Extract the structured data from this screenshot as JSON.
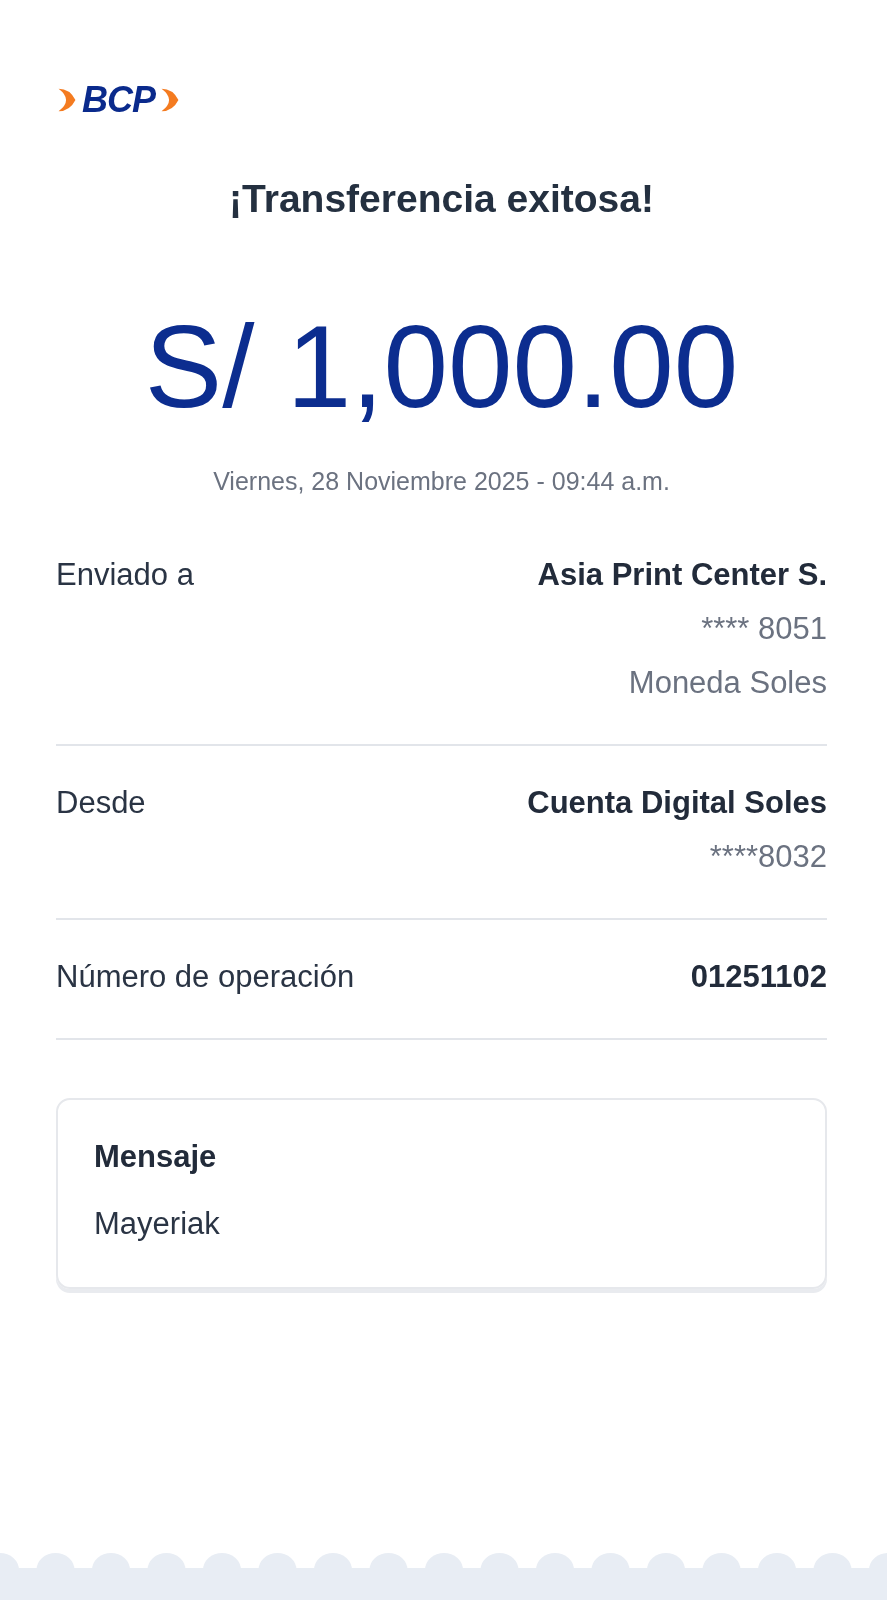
{
  "logo": {
    "text": "BCP"
  },
  "title": "¡Transferencia exitosa!",
  "amount": "S/ 1,000.00",
  "date": "Viernes, 28 Noviembre 2025 - 09:44 a.m.",
  "details": [
    {
      "label": "Enviado a",
      "lines": [
        "Asia Print Center S.",
        "**** 8051",
        "Moneda Soles"
      ]
    },
    {
      "label": "Desde",
      "lines": [
        "Cuenta Digital Soles",
        "****8032"
      ]
    },
    {
      "label": "Número de operación",
      "lines": [
        "01251102"
      ]
    }
  ],
  "message": {
    "label": "Mensaje",
    "text": "Mayeriak"
  }
}
